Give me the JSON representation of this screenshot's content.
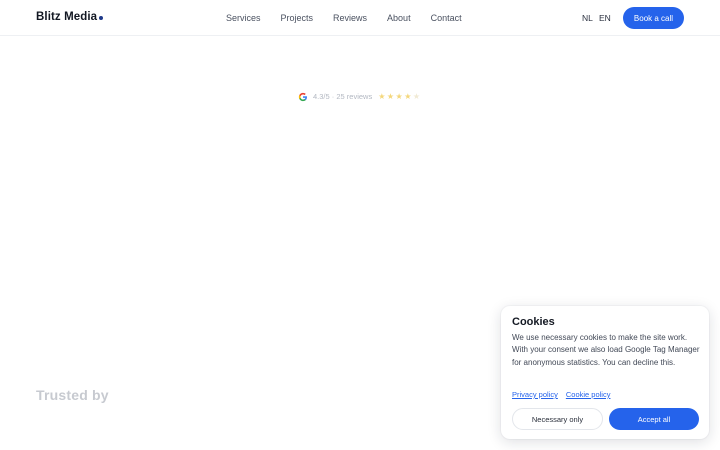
{
  "header": {
    "brand": "Blitz Media",
    "nav": [
      {
        "label": "Services"
      },
      {
        "label": "Projects"
      },
      {
        "label": "Reviews"
      },
      {
        "label": "About"
      },
      {
        "label": "Contact"
      }
    ],
    "languages": [
      "NL",
      "EN"
    ],
    "cta_label": "Book a call"
  },
  "hero": {
    "rating_text": "4.3/5 · 25 reviews",
    "rating_value": 4.3,
    "rating_max": 5,
    "rating_icon": "google-g-icon"
  },
  "trusted_by": "Trusted by",
  "cookie_banner": {
    "title": "Cookies",
    "body": "We use necessary cookies to make the site work. With your consent we also load Google Tag Manager for anonymous statistics. You can decline this.",
    "privacy_link": "Privacy policy",
    "cookie_link": "Cookie policy",
    "necessary_label": "Necessary only",
    "accept_label": "Accept all"
  },
  "colors": {
    "accent": "#2563eb",
    "star": "#f4d77b",
    "muted_heading": "#c7cad0"
  }
}
